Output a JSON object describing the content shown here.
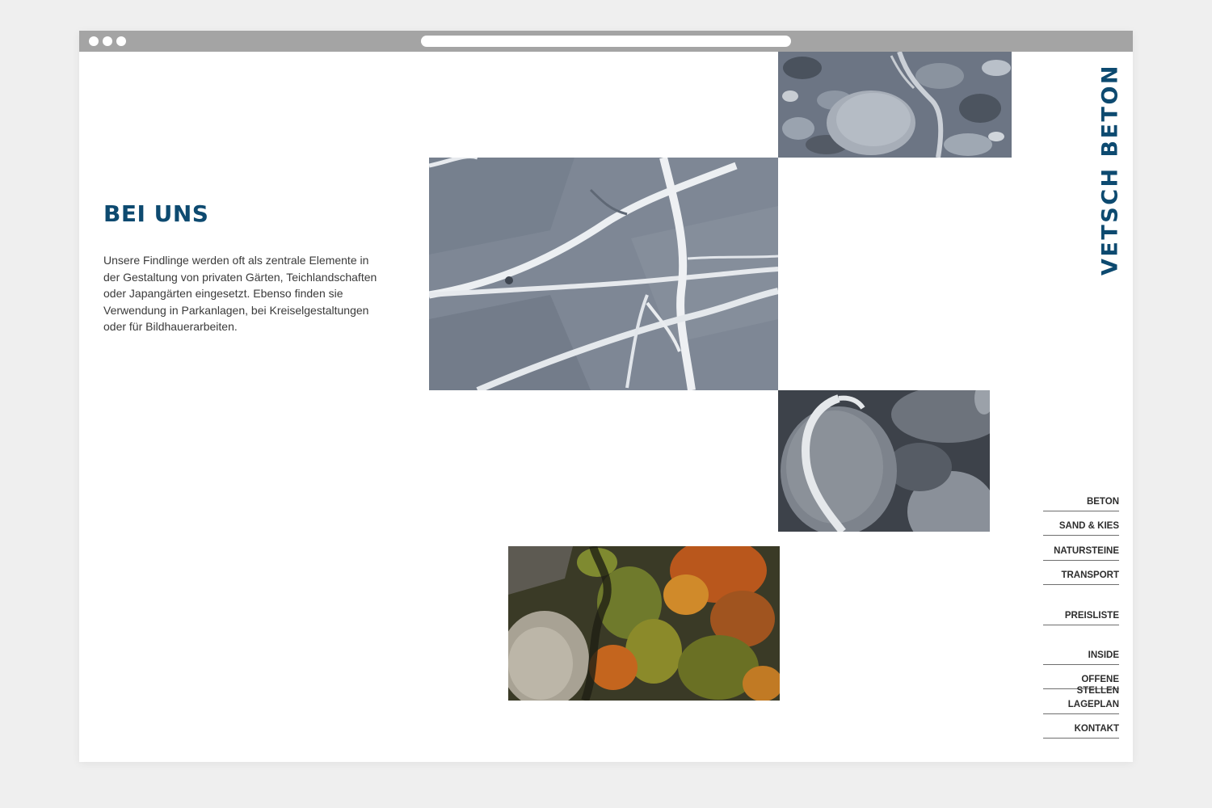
{
  "brand": {
    "logo_text": "VETSCH BETON",
    "color": "#0d4a70"
  },
  "content": {
    "heading": "BEI UNS",
    "paragraph": "Unsere Findlinge werden oft als zentrale Elemente in der Gestaltung von privaten Gärten, Teichlandschaften oder Japangärten eingesetzt. Ebenso finden sie Verwendung in Parkanlagen, bei Kreiselgestaltungen oder für Bildhauerarbeiten."
  },
  "nav": {
    "items": [
      {
        "label": "BETON"
      },
      {
        "label": "SAND & KIES"
      },
      {
        "label": "NATURSTEINE"
      },
      {
        "label": "TRANSPORT"
      },
      {
        "label": "PREISLISTE"
      },
      {
        "label": "INSIDE"
      },
      {
        "label": "OFFENE STELLEN"
      },
      {
        "label": "LAGEPLAN"
      },
      {
        "label": "KONTAKT"
      }
    ]
  },
  "images": [
    {
      "name": "river-stones-photo"
    },
    {
      "name": "veined-rock-photo"
    },
    {
      "name": "boulders-photo"
    },
    {
      "name": "autumn-gorge-photo"
    }
  ],
  "colors": {
    "chrome": "#a4a4a4",
    "background": "#efefef",
    "accent": "#0d4a70"
  }
}
